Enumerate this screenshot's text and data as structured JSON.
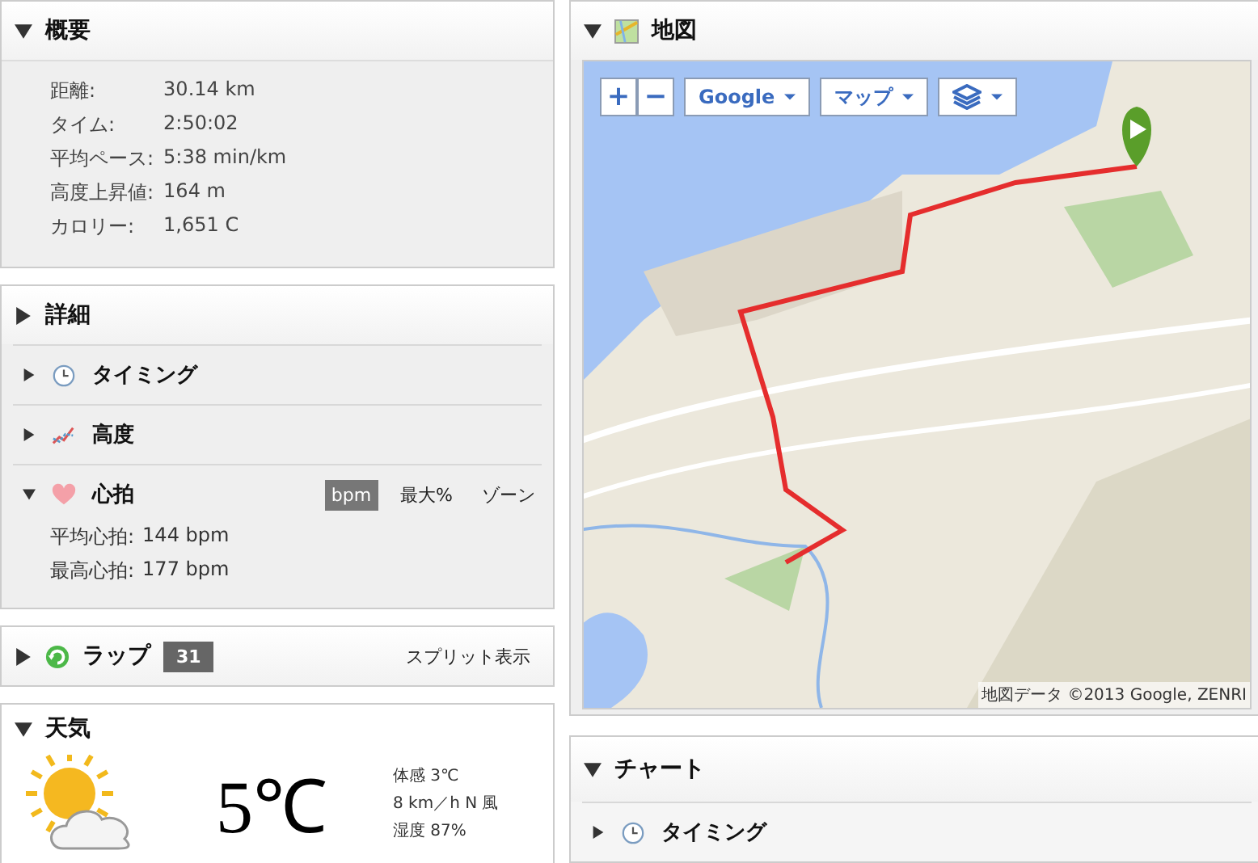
{
  "summary": {
    "title": "概要",
    "expanded": true,
    "stats": [
      {
        "label": "距離:",
        "value": "30.14 km"
      },
      {
        "label": "タイム:",
        "value": "2:50:02"
      },
      {
        "label": "平均ペース:",
        "value": "5:38 min/km"
      },
      {
        "label": "高度上昇値:",
        "value": "164 m"
      },
      {
        "label": "カロリー:",
        "value": "1,651 C"
      }
    ]
  },
  "details": {
    "title": "詳細",
    "expanded": false,
    "sections": [
      {
        "kind": "timing",
        "title": "タイミング",
        "expanded": false
      },
      {
        "kind": "elevation",
        "title": "高度",
        "expanded": false
      },
      {
        "kind": "heart",
        "title": "心拍",
        "expanded": true,
        "units": [
          {
            "label": "bpm",
            "selected": true
          },
          {
            "label": "最大%",
            "selected": false
          },
          {
            "label": "ゾーン",
            "selected": false
          }
        ],
        "stats": [
          {
            "label": "平均心拍:",
            "value": "144 bpm"
          },
          {
            "label": "最高心拍:",
            "value": "177 bpm"
          }
        ]
      }
    ]
  },
  "laps": {
    "title": "ラップ",
    "expanded": false,
    "count": "31",
    "action": "スプリット表示"
  },
  "weather": {
    "title": "天気",
    "expanded": true,
    "temperature": "5℃",
    "details": [
      "体感 3℃",
      "8 km／h N 風",
      "湿度 87%"
    ]
  },
  "map": {
    "title": "地図",
    "expanded": true,
    "zoom_in": "+",
    "zoom_out": "−",
    "provider": "Google",
    "map_type": "マップ",
    "attribution": "地図データ ©2013 Google, ZENRI"
  },
  "chart": {
    "title": "チャート",
    "expanded": true,
    "sections": [
      {
        "kind": "timing",
        "title": "タイミング",
        "expanded": false
      }
    ]
  }
}
